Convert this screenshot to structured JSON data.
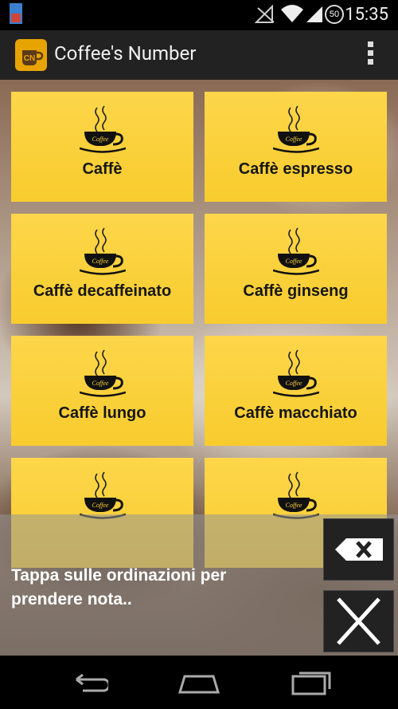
{
  "status_bar": {
    "time": "15:35",
    "icons": [
      "sim-icon",
      "signal-off-icon",
      "wifi-icon",
      "signal-icon",
      "battery-50-icon"
    ],
    "battery_level": "50"
  },
  "action_bar": {
    "title": "Coffee's Number",
    "logo_text": "CN"
  },
  "grid": {
    "cup_label": "Coffee",
    "items": [
      {
        "label": "Caffè"
      },
      {
        "label": "Caffè espresso"
      },
      {
        "label": "Caffè decaffeinato"
      },
      {
        "label": "Caffè ginseng"
      },
      {
        "label": "Caffè lungo"
      },
      {
        "label": "Caffè macchiato"
      },
      {
        "label": ""
      },
      {
        "label": ""
      }
    ]
  },
  "note_panel": {
    "text": "Tappa sulle ordinazioni per prendere nota..",
    "buttons": [
      "backspace-icon",
      "close-icon"
    ]
  },
  "nav_bar": {
    "buttons": [
      "back-icon",
      "home-icon",
      "recents-icon"
    ]
  },
  "colors": {
    "tile": "#fbd13a",
    "action_bar": "#222222",
    "logo": "#e7a400"
  }
}
